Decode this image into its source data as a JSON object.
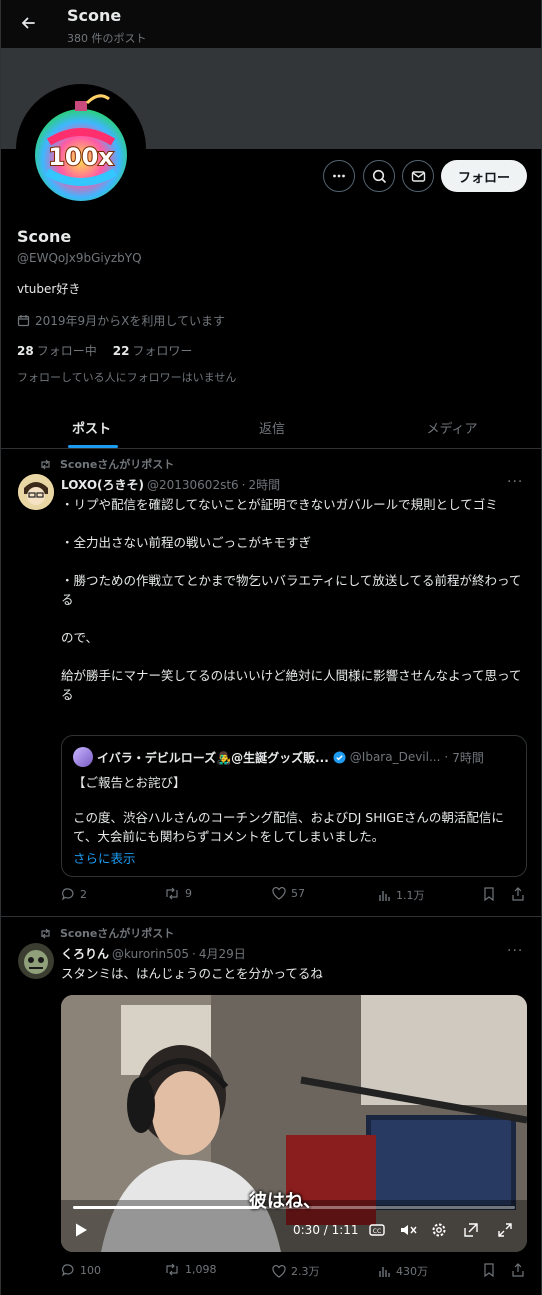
{
  "header": {
    "title": "Scone",
    "post_count": "380 件のポスト"
  },
  "profile": {
    "name": "Scone",
    "handle": "@EWQoJx9bGiyzbYQ",
    "bio": "vtuber好き",
    "joined": "2019年9月からXを利用しています",
    "following_count": "28",
    "following_label": "フォロー中",
    "followers_count": "22",
    "followers_label": "フォロワー",
    "no_mutuals": "フォローしている人にフォロワーはいません",
    "follow_button": "フォロー",
    "avatar_text": "100x"
  },
  "tabs": [
    "ポスト",
    "返信",
    "メディア"
  ],
  "posts": [
    {
      "repost_label": "Sconeさんがリポスト",
      "author": "LOXO(ろきそ)",
      "handle": "@20130602st6",
      "time": "2時間",
      "text": "・リプや配信を確認してないことが証明できないガバルールで規則としてゴミ\n\n・全力出さない前程の戦いごっこがキモすぎ\n\n・勝つための作戦立てとかまで物乞いバラエティにして放送してる前程が終わってる\n\nので、\n\n給が勝手にマナー笑してるのはいいけど絶対に人間様に影響させんなよって思ってる",
      "quote": {
        "author": "イバラ・デビルローズ👨‍🎤@生誕グッズ販...",
        "handle": "@Ibara_Devil...",
        "time": "7時間",
        "title": "【ご報告とお詫び】",
        "body": "この度、渋谷ハルさんのコーチング配信、およびDJ SHIGEさんの朝活配信にて、大会前にも関わらずコメントをしてしまいました。",
        "more": "さらに表示"
      },
      "stats": {
        "replies": "2",
        "reposts": "9",
        "likes": "57",
        "views": "1.1万"
      }
    },
    {
      "repost_label": "Sconeさんがリポスト",
      "author": "くろりん",
      "handle": "@kurorin505",
      "time": "4月29日",
      "text": "スタンミは、はんじょうのことを分かってるね",
      "video": {
        "caption": "彼はね、",
        "time": "0:30 / 1:11",
        "progress": 0.42
      },
      "stats": {
        "replies": "100",
        "reposts": "1,098",
        "likes": "2.3万",
        "views": "430万"
      }
    }
  ]
}
